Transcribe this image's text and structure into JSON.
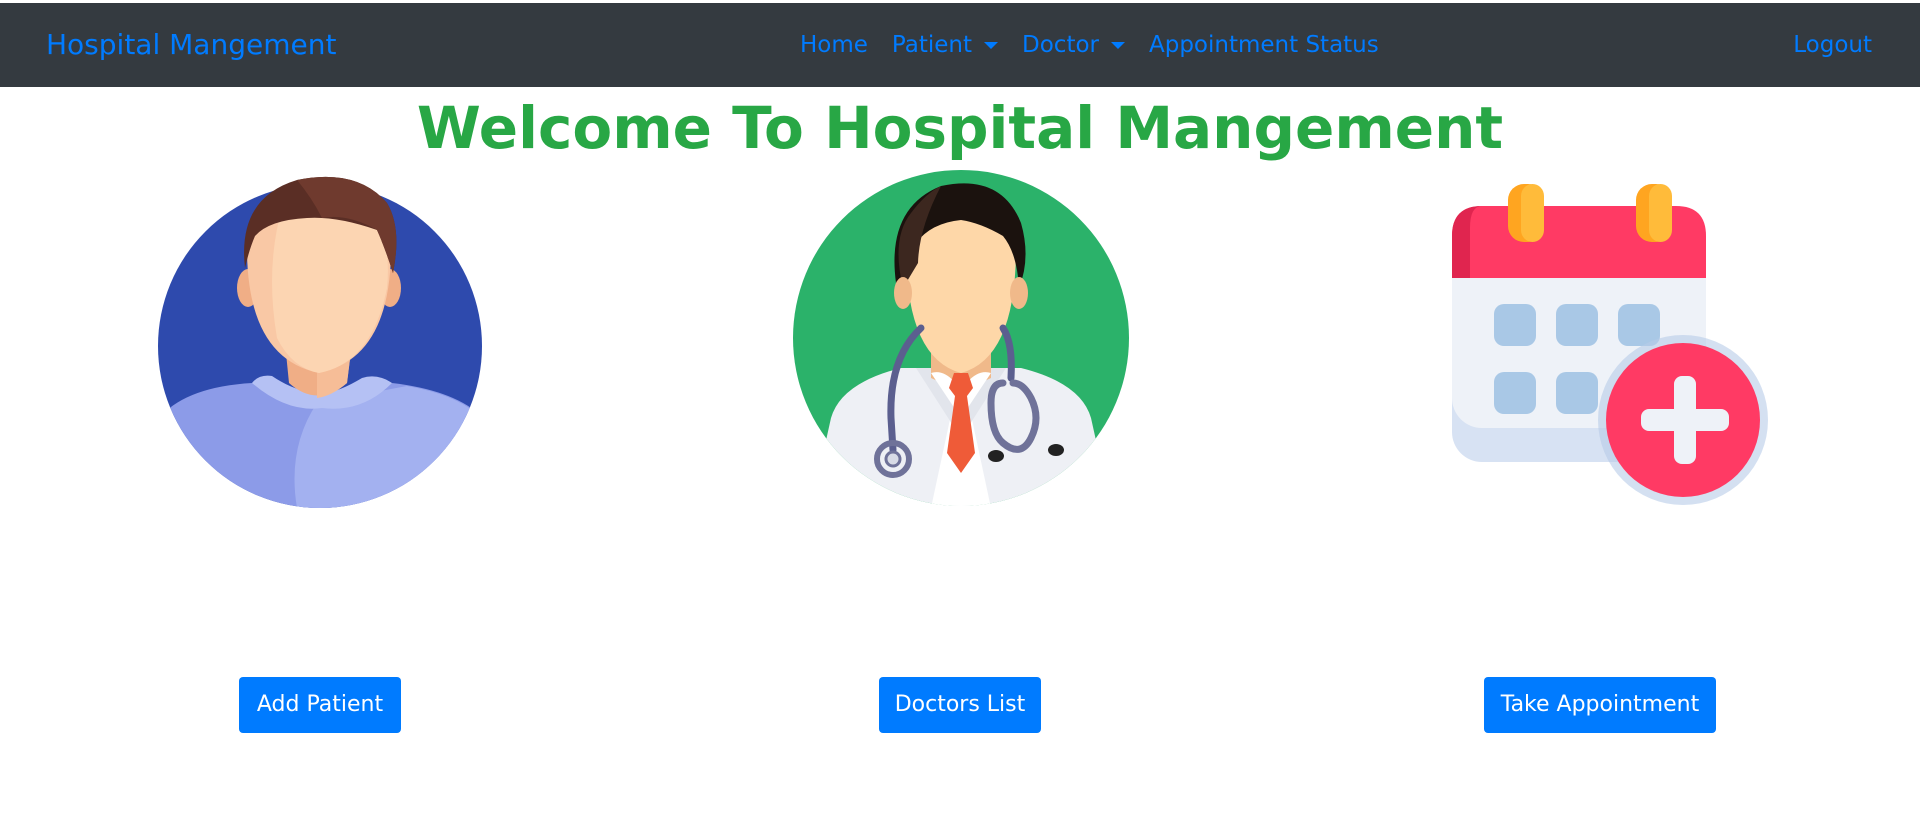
{
  "navbar": {
    "brand": "Hospital Mangement",
    "links": [
      {
        "label": "Home"
      },
      {
        "label": "Patient",
        "dropdown": true
      },
      {
        "label": "Doctor",
        "dropdown": true
      },
      {
        "label": "Appointment Status"
      }
    ],
    "logout": "Logout"
  },
  "main": {
    "heading": "Welcome To Hospital Mangement",
    "cards": [
      {
        "image_icon": "patient-avatar-icon",
        "button": "Add Patient"
      },
      {
        "image_icon": "doctor-avatar-icon",
        "button": "Doctors List"
      },
      {
        "image_icon": "calendar-add-icon",
        "button": "Take Appointment"
      }
    ]
  },
  "colors": {
    "navbar_bg": "#343a40",
    "link": "#007bff",
    "heading": "#28a745",
    "button_bg": "#007bff",
    "button_text": "#ffffff"
  }
}
